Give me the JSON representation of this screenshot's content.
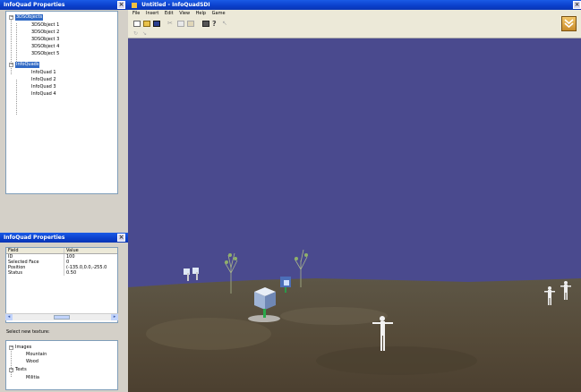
{
  "left": {
    "top_panel": {
      "title": "InfoQuad Properties",
      "tree": [
        {
          "label": "3DSObjects",
          "children": [
            "3DSObject 1",
            "3DSObject 2",
            "3DSObject 3",
            "3DSObject 4",
            "3DSObject 5"
          ]
        },
        {
          "label": "InfoQuads",
          "children": [
            "InfoQuad 1",
            "InfoQuad 2",
            "InfoQuad 3",
            "InfoQuad 4"
          ]
        }
      ]
    },
    "props_panel": {
      "title": "InfoQuad Properties",
      "columns": [
        "Field",
        "Value"
      ],
      "rows": [
        {
          "field": "ID",
          "value": "100"
        },
        {
          "field": "Selected Face",
          "value": "0"
        },
        {
          "field": "Position",
          "value": "(-135.0,0.0,-255.0"
        },
        {
          "field": "Status",
          "value": "0.50"
        }
      ],
      "texture_label": "Select new  texture:",
      "texture_tree": [
        {
          "label": "Images",
          "children": [
            "Mountain",
            "Wood"
          ]
        },
        {
          "label": "Texts",
          "children": [
            "Militia"
          ]
        }
      ]
    }
  },
  "app": {
    "title": "Untitled - InfoQuadSDI",
    "menu": [
      "File",
      "Insert",
      "Edit",
      "View",
      "Help",
      "Game"
    ],
    "toolbar_icons": [
      "new-file-icon",
      "open-folder-icon",
      "save-icon",
      "cut-icon",
      "copy-icon",
      "paste-icon",
      "print-icon",
      "help-icon",
      "pointer-icon"
    ],
    "toolbar2_icons": [
      "rotate-icon",
      "move-icon"
    ]
  },
  "colors": {
    "title_bar": "#0a3fcb",
    "sky": "#4a4a8e",
    "ground": "#544a3a",
    "selection": "#316ac5"
  }
}
